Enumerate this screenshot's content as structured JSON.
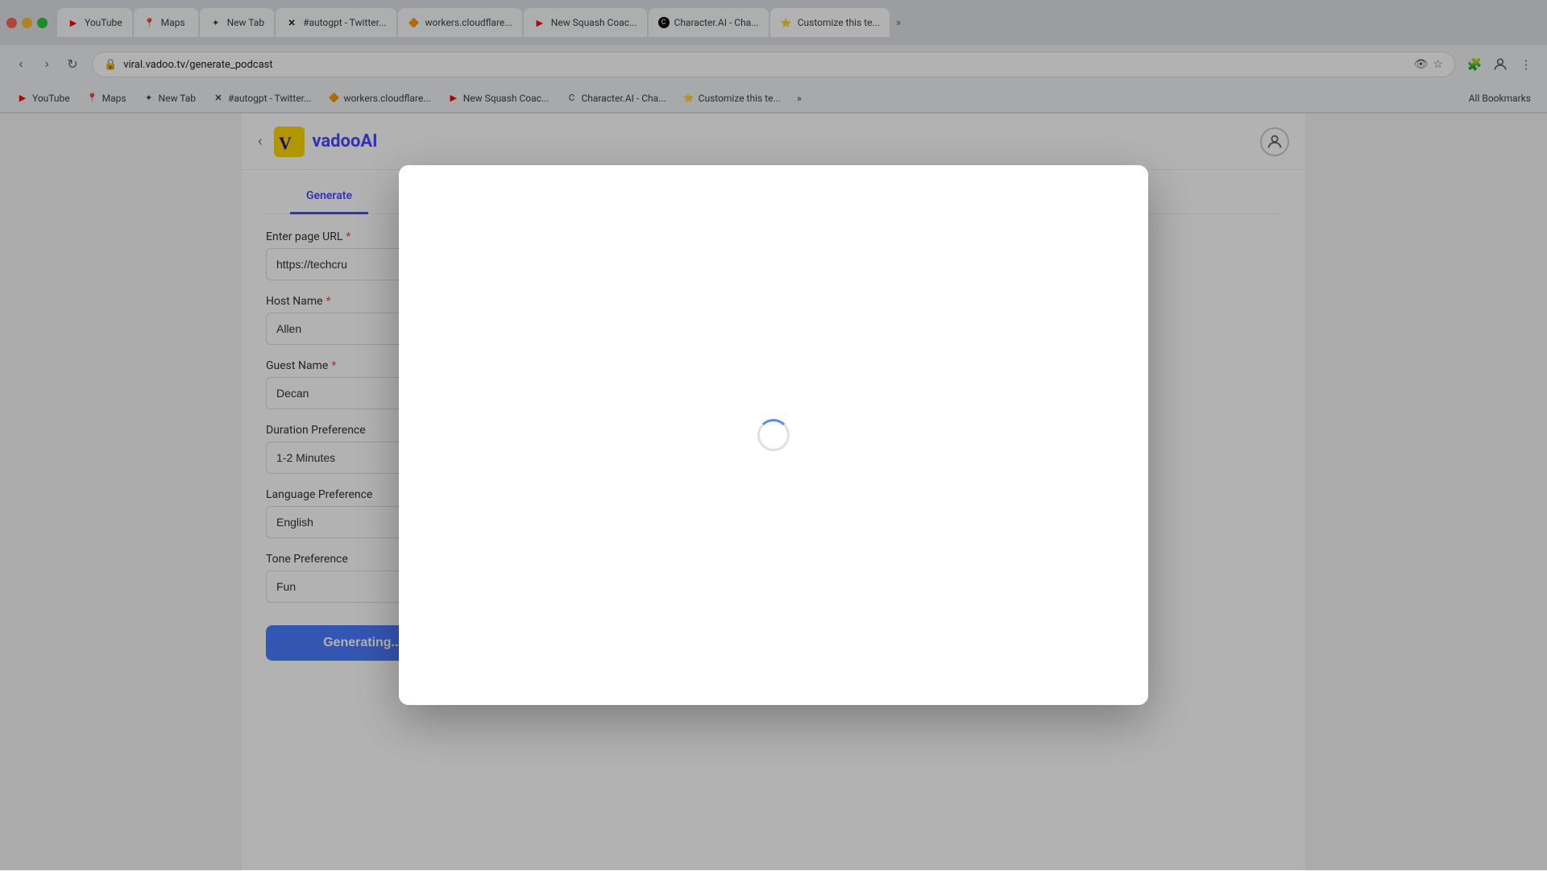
{
  "browser": {
    "address": "viral.vadoo.tv/generate_podcast",
    "tabs": [
      {
        "id": "youtube",
        "label": "YouTube",
        "favicon": "▶",
        "favicon_color": "#ff0000",
        "active": false
      },
      {
        "id": "maps",
        "label": "Maps",
        "favicon": "📍",
        "active": false
      },
      {
        "id": "new-tab",
        "label": "New Tab",
        "favicon": "✦",
        "active": false
      },
      {
        "id": "autogpt",
        "label": "#autogpt - Twitter...",
        "favicon": "✕",
        "active": false
      },
      {
        "id": "workers",
        "label": "workers.cloudflare...",
        "favicon": "🔶",
        "active": false
      },
      {
        "id": "squash",
        "label": "New Squash Coac...",
        "favicon": "▶",
        "favicon_color": "#ff0000",
        "active": false
      },
      {
        "id": "character",
        "label": "Character.AI - Cha...",
        "favicon": "C",
        "active": false
      },
      {
        "id": "customize",
        "label": "Customize this te...",
        "favicon": "✦",
        "active": true
      }
    ],
    "bookmarks": [
      {
        "label": "YouTube",
        "favicon": "▶"
      },
      {
        "label": "Maps",
        "favicon": "📍"
      },
      {
        "label": "New Tab",
        "favicon": ""
      },
      {
        "label": "#autogpt - Twitter...",
        "favicon": "✕"
      },
      {
        "label": "workers.cloudflare...",
        "favicon": "🔶"
      },
      {
        "label": "New Squash Coac...",
        "favicon": "▶"
      },
      {
        "label": "Character.AI - Cha...",
        "favicon": "C"
      },
      {
        "label": "Customize this te...",
        "favicon": "⭐"
      }
    ],
    "more_tabs_label": "»",
    "all_bookmarks_label": "All Bookmarks"
  },
  "vadoo": {
    "logo_v": "V",
    "logo_text": "vadoo",
    "logo_ai": "AI",
    "nav_back": "‹",
    "user_icon": "👤",
    "app_tab_label": "Generate"
  },
  "form": {
    "section_title": "Generate",
    "url_label": "Enter page URL",
    "url_required": "*",
    "url_value": "https://techcru",
    "host_label": "Host Name",
    "host_required": "*",
    "host_value": "Allen",
    "guest_label": "Guest Name",
    "guest_required": "*",
    "guest_value": "Decan",
    "duration_label": "Duration Preference",
    "duration_value": "1-2 Minutes",
    "language_label": "Language Preference",
    "language_value": "English",
    "tone_label": "Tone Preference",
    "tone_value": "Fun",
    "generate_btn_label": "Generating..."
  },
  "modal": {
    "visible": true,
    "spinner_label": "loading"
  },
  "colors": {
    "accent": "#4a7bff",
    "vadoo_blue": "#4a4aff",
    "required_red": "#ff4444",
    "spinner_blue": "#5b8af5"
  }
}
